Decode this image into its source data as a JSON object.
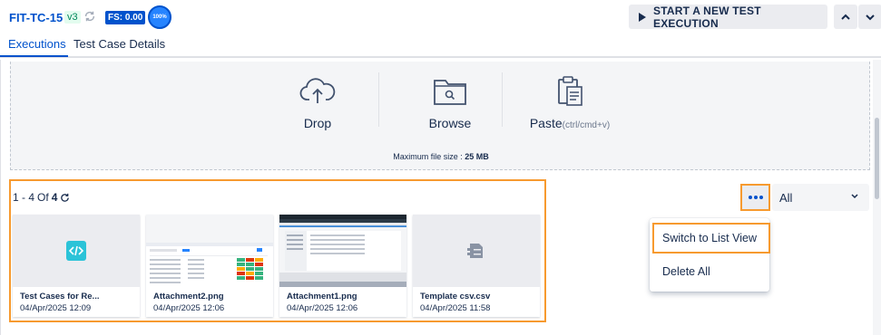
{
  "header": {
    "test_case_key": "FIT-TC-15",
    "version": "v3",
    "fs_label": "FS: 0.00",
    "progress": "100%",
    "start_button_label": "START A NEW TEST EXECUTION"
  },
  "tabs": [
    {
      "label": "Executions",
      "active": true
    },
    {
      "label": "Test Case Details",
      "active": false
    }
  ],
  "dropzone": {
    "drop_label": "Drop",
    "browse_label": "Browse",
    "paste_label": "Paste",
    "paste_hint": "(ctrl/cmd+v)",
    "max_size_prefix": "Maximum file size : ",
    "max_size_value": "25 MB"
  },
  "attachments": {
    "range_text": "1 - 4",
    "of_text": "Of",
    "total": "4",
    "items": [
      {
        "name": "Test Cases for Re...",
        "date": "04/Apr/2025 12:09",
        "thumb": "code-file-icon"
      },
      {
        "name": "Attachment2.png",
        "date": "04/Apr/2025 12:06",
        "thumb": "screenshot"
      },
      {
        "name": "Attachment1.png",
        "date": "04/Apr/2025 12:06",
        "thumb": "screenshot-dark"
      },
      {
        "name": "Template csv.csv",
        "date": "04/Apr/2025 11:58",
        "thumb": "generic-file-icon"
      }
    ]
  },
  "filter": {
    "selected": "All"
  },
  "menu": {
    "switch_view_label": "Switch to List View",
    "delete_all_label": "Delete All"
  },
  "colors": {
    "primary": "#0052cc",
    "highlight": "#f79a2f",
    "code_icon": "#2bc3d8"
  }
}
